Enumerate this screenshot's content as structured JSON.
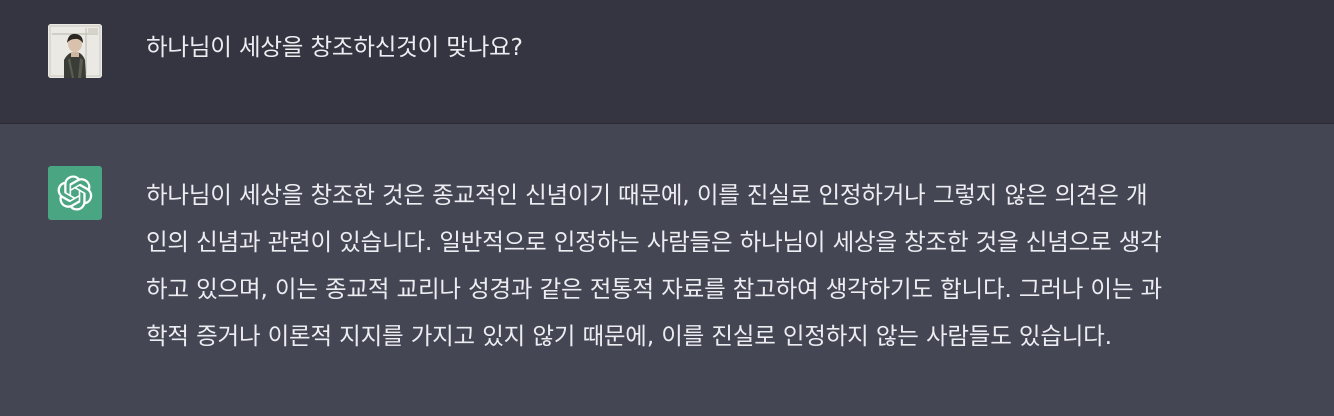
{
  "conversation": {
    "user_message": "하나님이 세상을 창조하신것이 맞나요?",
    "assistant_message_lines": [
      "하나님이 세상을 창조한 것은 종교적인 신념이기 때문에, 이를 진실로 인정하거나 그렇지 않은 의견은 개",
      "인의 신념과 관련이 있습니다. 일반적으로 인정하는 사람들은 하나님이 세상을 창조한 것을 신념으로 생각",
      "하고 있으며, 이는 종교적 교리나 성경과 같은 전통적 자료를 참고하여 생각하기도 합니다. 그러나 이는 과",
      "학적 증거나 이론적 지지를 가지고 있지 않기 때문에, 이를 진실로 인정하지 않는 사람들도 있습니다."
    ]
  },
  "icons": {
    "user_avatar": "user-avatar-photo",
    "assistant_avatar": "openai-logo-icon"
  },
  "colors": {
    "user_row_bg": "#343541",
    "assistant_row_bg": "#444654",
    "assistant_avatar_bg": "#4aa583",
    "text": "#ececf1"
  }
}
